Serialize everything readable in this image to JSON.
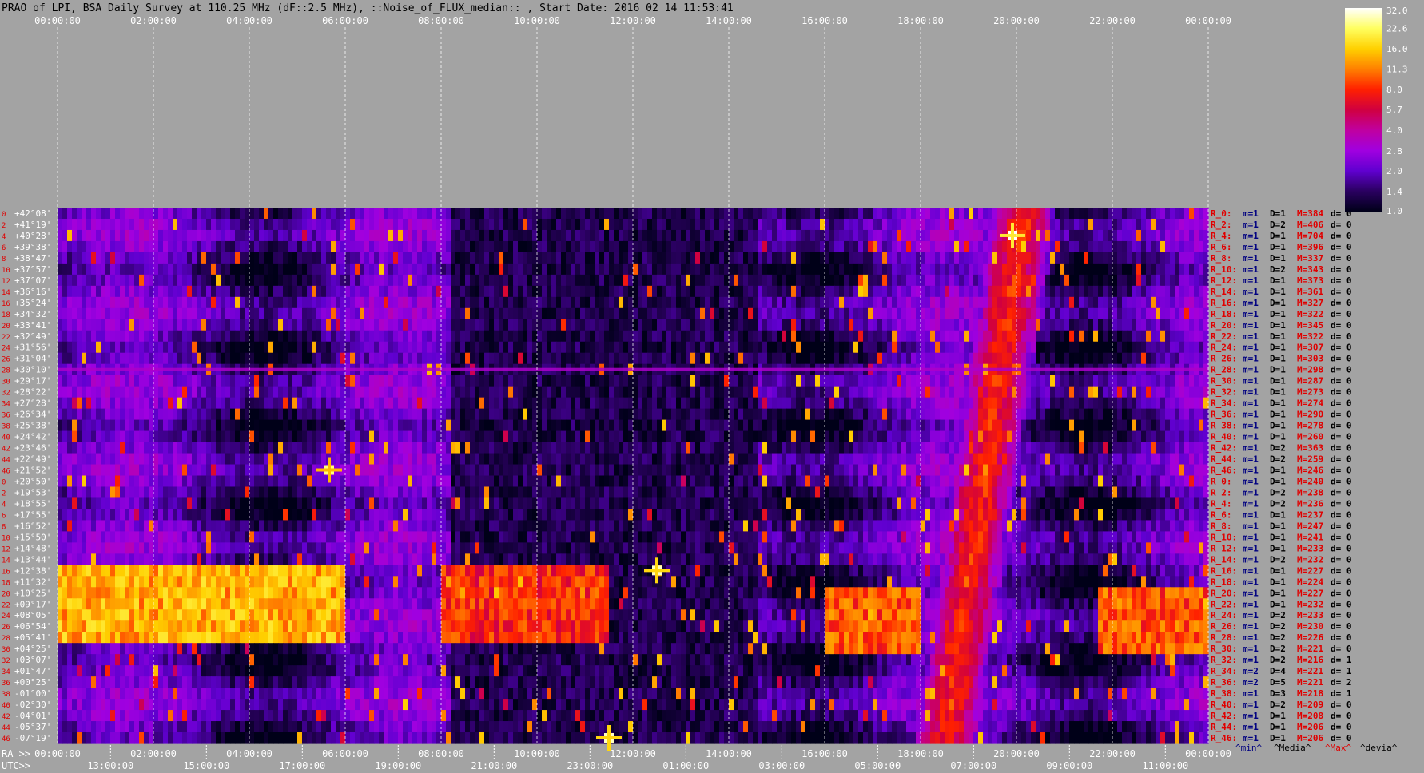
{
  "title": "PRAO of LPI, BSA Daily Survey at 110.25 MHz (dF::2.5 MHz), ::Noise_of_FLUX_median:: , Start Date: 2016 02 14 11:53:41",
  "colors": {
    "background": "#a3a3a3",
    "grid": "#ffffff",
    "title_text": "#000000",
    "axis_text": "#ffffff",
    "stats_label": "#e00000",
    "stats_min": "#000080",
    "stats_max": "#e00000"
  },
  "chart_data": {
    "type": "heatmap",
    "title": "PRAO of LPI, BSA Daily Survey at 110.25 MHz (dF::2.5 MHz), ::Noise_of_FLUX_median:: , Start Date: 2016 02 14 11:53:41",
    "top_axis": {
      "tick_labels": [
        "00:00:00",
        "02:00:00",
        "04:00:00",
        "06:00:00",
        "08:00:00",
        "10:00:00",
        "12:00:00",
        "14:00:00",
        "16:00:00",
        "18:00:00",
        "20:00:00",
        "22:00:00",
        "00:00:00"
      ],
      "grid": true
    },
    "bottom_axis": {
      "ra_prefix": "RA >>",
      "ra_ticks": [
        "00:00:00",
        "02:00:00",
        "04:00:00",
        "06:00:00",
        "08:00:00",
        "10:00:00",
        "12:00:00",
        "14:00:00",
        "16:00:00",
        "18:00:00",
        "20:00:00",
        "22:00:00",
        "00:00:00"
      ],
      "utc_prefix": "UTC>>",
      "utc_ticks": [
        "13:00:00",
        "15:00:00",
        "17:00:00",
        "19:00:00",
        "21:00:00",
        "23:00:00",
        "01:00:00",
        "03:00:00",
        "05:00:00",
        "07:00:00",
        "09:00:00",
        "11:00:00"
      ]
    },
    "rows": [
      {
        "index": "0",
        "dec": "+42°08'",
        "label": "R_0:",
        "min": "m=1",
        "dev": "D=1",
        "max": "M=384",
        "d": "d= 0"
      },
      {
        "index": "2",
        "dec": "+41°19'",
        "label": "R_2:",
        "min": "m=1",
        "dev": "D=2",
        "max": "M=406",
        "d": "d= 0"
      },
      {
        "index": "4",
        "dec": "+40°28'",
        "label": "R_4:",
        "min": "m=1",
        "dev": "D=1",
        "max": "M=704",
        "d": "d= 0"
      },
      {
        "index": "6",
        "dec": "+39°38'",
        "label": "R_6:",
        "min": "m=1",
        "dev": "D=1",
        "max": "M=396",
        "d": "d= 0"
      },
      {
        "index": "8",
        "dec": "+38°47'",
        "label": "R_8:",
        "min": "m=1",
        "dev": "D=1",
        "max": "M=337",
        "d": "d= 0"
      },
      {
        "index": "10",
        "dec": "+37°57'",
        "label": "R_10:",
        "min": "m=1",
        "dev": "D=2",
        "max": "M=343",
        "d": "d= 0"
      },
      {
        "index": "12",
        "dec": "+37°07'",
        "label": "R_12:",
        "min": "m=1",
        "dev": "D=1",
        "max": "M=373",
        "d": "d= 0"
      },
      {
        "index": "14",
        "dec": "+36°16'",
        "label": "R_14:",
        "min": "m=1",
        "dev": "D=1",
        "max": "M=361",
        "d": "d= 0"
      },
      {
        "index": "16",
        "dec": "+35°24'",
        "label": "R_16:",
        "min": "m=1",
        "dev": "D=1",
        "max": "M=327",
        "d": "d= 0"
      },
      {
        "index": "18",
        "dec": "+34°32'",
        "label": "R_18:",
        "min": "m=1",
        "dev": "D=1",
        "max": "M=322",
        "d": "d= 0"
      },
      {
        "index": "20",
        "dec": "+33°41'",
        "label": "R_20:",
        "min": "m=1",
        "dev": "D=1",
        "max": "M=345",
        "d": "d= 0"
      },
      {
        "index": "22",
        "dec": "+32°49'",
        "label": "R_22:",
        "min": "m=1",
        "dev": "D=1",
        "max": "M=322",
        "d": "d= 0"
      },
      {
        "index": "24",
        "dec": "+31°56'",
        "label": "R_24:",
        "min": "m=1",
        "dev": "D=1",
        "max": "M=307",
        "d": "d= 0"
      },
      {
        "index": "26",
        "dec": "+31°04'",
        "label": "R_26:",
        "min": "m=1",
        "dev": "D=1",
        "max": "M=303",
        "d": "d= 0"
      },
      {
        "index": "28",
        "dec": "+30°10'",
        "label": "R_28:",
        "min": "m=1",
        "dev": "D=1",
        "max": "M=298",
        "d": "d= 0"
      },
      {
        "index": "30",
        "dec": "+29°17'",
        "label": "R_30:",
        "min": "m=1",
        "dev": "D=1",
        "max": "M=287",
        "d": "d= 0"
      },
      {
        "index": "32",
        "dec": "+28°22'",
        "label": "R_32:",
        "min": "m=1",
        "dev": "D=1",
        "max": "M=273",
        "d": "d= 0"
      },
      {
        "index": "34",
        "dec": "+27°28'",
        "label": "R_34:",
        "min": "m=1",
        "dev": "D=1",
        "max": "M=274",
        "d": "d= 0"
      },
      {
        "index": "36",
        "dec": "+26°34'",
        "label": "R_36:",
        "min": "m=1",
        "dev": "D=1",
        "max": "M=290",
        "d": "d= 0"
      },
      {
        "index": "38",
        "dec": "+25°38'",
        "label": "R_38:",
        "min": "m=1",
        "dev": "D=1",
        "max": "M=278",
        "d": "d= 0"
      },
      {
        "index": "40",
        "dec": "+24°42'",
        "label": "R_40:",
        "min": "m=1",
        "dev": "D=1",
        "max": "M=260",
        "d": "d= 0"
      },
      {
        "index": "42",
        "dec": "+23°46'",
        "label": "R_42:",
        "min": "m=1",
        "dev": "D=2",
        "max": "M=363",
        "d": "d= 0"
      },
      {
        "index": "44",
        "dec": "+22°49'",
        "label": "R_44:",
        "min": "m=1",
        "dev": "D=2",
        "max": "M=259",
        "d": "d= 0"
      },
      {
        "index": "46",
        "dec": "+21°52'",
        "label": "R_46:",
        "min": "m=1",
        "dev": "D=1",
        "max": "M=246",
        "d": "d= 0"
      },
      {
        "index": "0",
        "dec": "+20°50'",
        "label": "R_0:",
        "min": "m=1",
        "dev": "D=1",
        "max": "M=240",
        "d": "d= 0"
      },
      {
        "index": "2",
        "dec": "+19°53'",
        "label": "R_2:",
        "min": "m=1",
        "dev": "D=2",
        "max": "M=238",
        "d": "d= 0"
      },
      {
        "index": "4",
        "dec": "+18°55'",
        "label": "R_4:",
        "min": "m=1",
        "dev": "D=2",
        "max": "M=236",
        "d": "d= 0"
      },
      {
        "index": "6",
        "dec": "+17°55'",
        "label": "R_6:",
        "min": "m=1",
        "dev": "D=1",
        "max": "M=237",
        "d": "d= 0"
      },
      {
        "index": "8",
        "dec": "+16°52'",
        "label": "R_8:",
        "min": "m=1",
        "dev": "D=1",
        "max": "M=247",
        "d": "d= 0"
      },
      {
        "index": "10",
        "dec": "+15°50'",
        "label": "R_10:",
        "min": "m=1",
        "dev": "D=1",
        "max": "M=241",
        "d": "d= 0"
      },
      {
        "index": "12",
        "dec": "+14°48'",
        "label": "R_12:",
        "min": "m=1",
        "dev": "D=1",
        "max": "M=233",
        "d": "d= 0"
      },
      {
        "index": "14",
        "dec": "+13°44'",
        "label": "R_14:",
        "min": "m=1",
        "dev": "D=2",
        "max": "M=232",
        "d": "d= 0"
      },
      {
        "index": "16",
        "dec": "+12°38'",
        "label": "R_16:",
        "min": "m=1",
        "dev": "D=1",
        "max": "M=227",
        "d": "d= 0"
      },
      {
        "index": "18",
        "dec": "+11°32'",
        "label": "R_18:",
        "min": "m=1",
        "dev": "D=1",
        "max": "M=224",
        "d": "d= 0"
      },
      {
        "index": "20",
        "dec": "+10°25'",
        "label": "R_20:",
        "min": "m=1",
        "dev": "D=1",
        "max": "M=227",
        "d": "d= 0"
      },
      {
        "index": "22",
        "dec": "+09°17'",
        "label": "R_22:",
        "min": "m=1",
        "dev": "D=1",
        "max": "M=232",
        "d": "d= 0"
      },
      {
        "index": "24",
        "dec": "+08°05'",
        "label": "R_24:",
        "min": "m=1",
        "dev": "D=2",
        "max": "M=233",
        "d": "d= 0"
      },
      {
        "index": "26",
        "dec": "+06°54'",
        "label": "R_26:",
        "min": "m=1",
        "dev": "D=2",
        "max": "M=230",
        "d": "d= 0"
      },
      {
        "index": "28",
        "dec": "+05°41'",
        "label": "R_28:",
        "min": "m=1",
        "dev": "D=2",
        "max": "M=226",
        "d": "d= 0"
      },
      {
        "index": "30",
        "dec": "+04°25'",
        "label": "R_30:",
        "min": "m=1",
        "dev": "D=2",
        "max": "M=221",
        "d": "d= 0"
      },
      {
        "index": "32",
        "dec": "+03°07'",
        "label": "R_32:",
        "min": "m=1",
        "dev": "D=2",
        "max": "M=216",
        "d": "d= 1"
      },
      {
        "index": "34",
        "dec": "+01°47'",
        "label": "R_34:",
        "min": "m=2",
        "dev": "D=4",
        "max": "M=221",
        "d": "d= 1"
      },
      {
        "index": "36",
        "dec": "+00°25'",
        "label": "R_36:",
        "min": "m=2",
        "dev": "D=5",
        "max": "M=221",
        "d": "d= 2"
      },
      {
        "index": "38",
        "dec": "-01°00'",
        "label": "R_38:",
        "min": "m=1",
        "dev": "D=3",
        "max": "M=218",
        "d": "d= 1"
      },
      {
        "index": "40",
        "dec": "-02°30'",
        "label": "R_40:",
        "min": "m=1",
        "dev": "D=2",
        "max": "M=209",
        "d": "d= 0"
      },
      {
        "index": "42",
        "dec": "-04°01'",
        "label": "R_42:",
        "min": "m=1",
        "dev": "D=1",
        "max": "M=208",
        "d": "d= 0"
      },
      {
        "index": "44",
        "dec": "-05°37'",
        "label": "R_44:",
        "min": "m=1",
        "dev": "D=1",
        "max": "M=206",
        "d": "d= 0"
      },
      {
        "index": "46",
        "dec": "-07°19'",
        "label": "R_46:",
        "min": "m=1",
        "dev": "D=1",
        "max": "M=206",
        "d": "d= 0"
      }
    ],
    "stats_footer": [
      "^min^",
      "^Media^",
      "^Max^",
      "^devia^"
    ],
    "colorbar": {
      "tick_labels": [
        "32.0",
        "22.6",
        "16.0",
        "11.3",
        "8.0",
        "5.7",
        "4.0",
        "2.8",
        "2.0",
        "1.4",
        "1.0"
      ],
      "range": [
        1.0,
        32.0
      ],
      "scale": "log",
      "palette": [
        "#ffffff",
        "#ffff60",
        "#ffd000",
        "#ff8000",
        "#ff2000",
        "#d00040",
        "#c000a0",
        "#a000e0",
        "#6000d0",
        "#2a0060",
        "#000018"
      ]
    },
    "features": [
      {
        "kind": "band",
        "rows": [
          32,
          38
        ],
        "from_ra": "00:00:00",
        "to_ra": "06:00:00",
        "level": 16
      },
      {
        "kind": "band",
        "rows": [
          32,
          38
        ],
        "from_ra": "08:00:00",
        "to_ra": "11:30:00",
        "level": 9
      },
      {
        "kind": "band",
        "rows": [
          34,
          39
        ],
        "from_ra": "16:00:00",
        "to_ra": "18:00:00",
        "level": 11
      },
      {
        "kind": "band",
        "rows": [
          34,
          39
        ],
        "from_ra": "21:40:00",
        "to_ra": "00:00:00",
        "level": 11
      },
      {
        "kind": "source",
        "dec": "+40°28'",
        "ra": "19:55:00",
        "level": 32
      },
      {
        "kind": "source",
        "dec": "+21°52'",
        "ra": "05:40:00",
        "level": 24
      },
      {
        "kind": "source",
        "dec": "+12°38'",
        "ra": "12:30:00",
        "level": 28
      },
      {
        "kind": "source",
        "dec": "-07°19'",
        "ra": "11:30:00",
        "level": 28
      },
      {
        "kind": "arc",
        "from_ra": "18:30:00",
        "to_ra": "20:05:00",
        "level": 8
      }
    ]
  }
}
